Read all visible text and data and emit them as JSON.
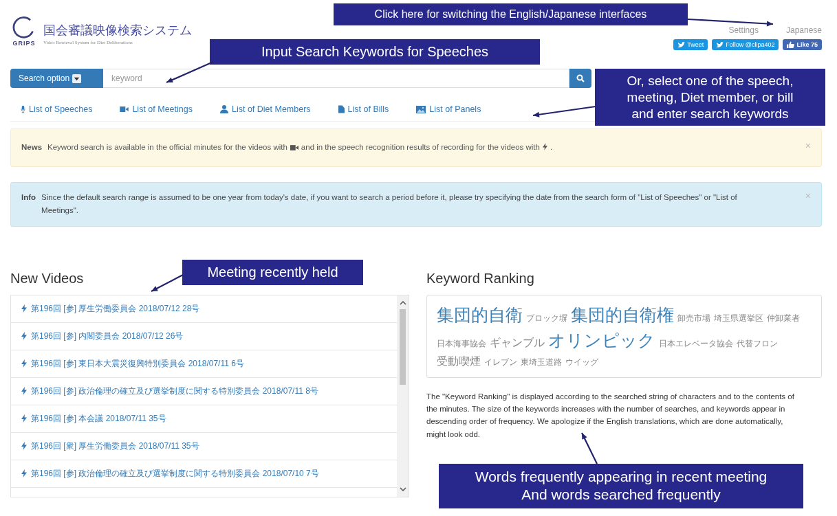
{
  "header": {
    "logo_text": "GRIPS",
    "title": "国会審議映像検索システム",
    "subtitle": "Video Retrieval System for Diet Deliberations",
    "nav_links": [
      "Settings",
      "Japanese"
    ],
    "social": [
      {
        "kind": "tweet",
        "label": "Tweet"
      },
      {
        "kind": "follow",
        "label": "Follow @clipa402"
      },
      {
        "kind": "like",
        "label": "Like 75"
      }
    ]
  },
  "search": {
    "option_label": "Search option",
    "placeholder": "keyword"
  },
  "list_links": [
    {
      "kind": "mic",
      "label": "List of Speeches"
    },
    {
      "kind": "camera",
      "label": "List of Meetings"
    },
    {
      "kind": "person",
      "label": "List of Diet Members"
    },
    {
      "kind": "file",
      "label": "List of Bills"
    },
    {
      "kind": "image",
      "label": "List of Panels"
    }
  ],
  "alerts": [
    {
      "kind": "warning",
      "title": "News",
      "close": "×",
      "segments": [
        {
          "kind": "text",
          "text": "Keyword search is available in the official minutes for the videos with"
        },
        {
          "kind": "camera"
        },
        {
          "kind": "text",
          "text": "and in the speech recognition results of recording for the videos with"
        },
        {
          "kind": "bolt"
        },
        {
          "kind": "text",
          "text": "."
        }
      ]
    },
    {
      "kind": "info",
      "title": "Info",
      "close": "×",
      "segments": [
        {
          "kind": "text",
          "text": "Since the default search range is assumed to be one year from today's date, if you want to search a period before it, please try specifying the date from the search form of \"List of Speeches\" or \"List of Meetings\"."
        }
      ]
    }
  ],
  "new_videos": {
    "heading": "New Videos",
    "items": [
      "第196回 [参] 厚生労働委員会 2018/07/12 28号",
      "第196回 [参] 内閣委員会 2018/07/12 26号",
      "第196回 [参] 東日本大震災復興特別委員会 2018/07/11 6号",
      "第196回 [参] 政治倫理の確立及び選挙制度に関する特別委員会 2018/07/11 8号",
      "第196回 [参] 本会議 2018/07/11 35号",
      "第196回 [衆] 厚生労働委員会 2018/07/11 35号",
      "第196回 [参] 政治倫理の確立及び選挙制度に関する特別委員会 2018/07/10 7号"
    ]
  },
  "keyword_ranking": {
    "heading": "Keyword Ranking",
    "keywords": [
      {
        "text": "集団的自衛",
        "kind": "large"
      },
      {
        "text": "ブロック塀",
        "kind": "small"
      },
      {
        "text": "集団的自衛権",
        "kind": "large"
      },
      {
        "text": "卸売市場",
        "kind": "small"
      },
      {
        "text": "埼玉県選挙区",
        "kind": "small"
      },
      {
        "text": "仲卸業者",
        "kind": "small"
      },
      {
        "text": "日本海事協会",
        "kind": "small"
      },
      {
        "text": "ギャンブル",
        "kind": "medium"
      },
      {
        "text": "オリンピック",
        "kind": "large"
      },
      {
        "text": "日本エレベータ協会",
        "kind": "small"
      },
      {
        "text": "代替フロン",
        "kind": "small"
      },
      {
        "text": "受動喫煙",
        "kind": "medium"
      },
      {
        "text": "イレブン",
        "kind": "small"
      },
      {
        "text": "東埼玉道路",
        "kind": "small"
      },
      {
        "text": "ウイッグ",
        "kind": "small"
      }
    ],
    "description": "The \"Keyword Ranking\" is displayed according to the searched string of characters and to the contents of the minutes. The size of the keywords increases with the number of searches, and keywords appear in descending order of frequency. We apologize if the English translations, which are done automatically, might look odd."
  },
  "annotations": [
    {
      "lines": [
        "Click here for switching the English/Japanese interfaces"
      ]
    },
    {
      "lines": [
        "Input Search Keywords for Speeches"
      ]
    },
    {
      "lines": [
        "Or, select one of the speech,",
        "meeting, Diet member, or bill",
        "and enter search keywords"
      ]
    },
    {
      "lines": [
        "Meeting recently held"
      ]
    },
    {
      "lines": [
        "Words frequently appearing in recent meeting",
        "And words searched frequently"
      ]
    }
  ]
}
